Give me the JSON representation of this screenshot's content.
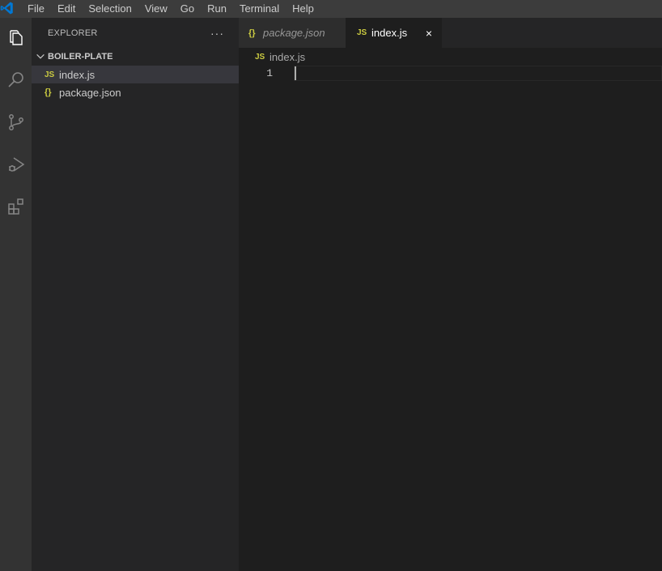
{
  "menu": [
    "File",
    "Edit",
    "Selection",
    "View",
    "Go",
    "Run",
    "Terminal",
    "Help"
  ],
  "activity_bar": [
    "explorer-icon",
    "search-icon",
    "source-control-icon",
    "run-debug-icon",
    "extensions-icon"
  ],
  "sidebar": {
    "title": "EXPLORER",
    "more": "···",
    "folder": "BOILER-PLATE",
    "files": [
      {
        "icon": "JS",
        "name": "index.js",
        "active": true
      },
      {
        "icon": "{}",
        "name": "package.json",
        "active": false
      }
    ]
  },
  "tabs": [
    {
      "icon": "{}",
      "label": "package.json",
      "active": false
    },
    {
      "icon": "JS",
      "label": "index.js",
      "active": true,
      "close": "×"
    }
  ],
  "breadcrumb": {
    "icon": "JS",
    "label": "index.js"
  },
  "editor": {
    "line_numbers": [
      "1"
    ]
  },
  "colors": {
    "accent_js": "#cbcb41",
    "vscode_blue": "#0078d4"
  }
}
